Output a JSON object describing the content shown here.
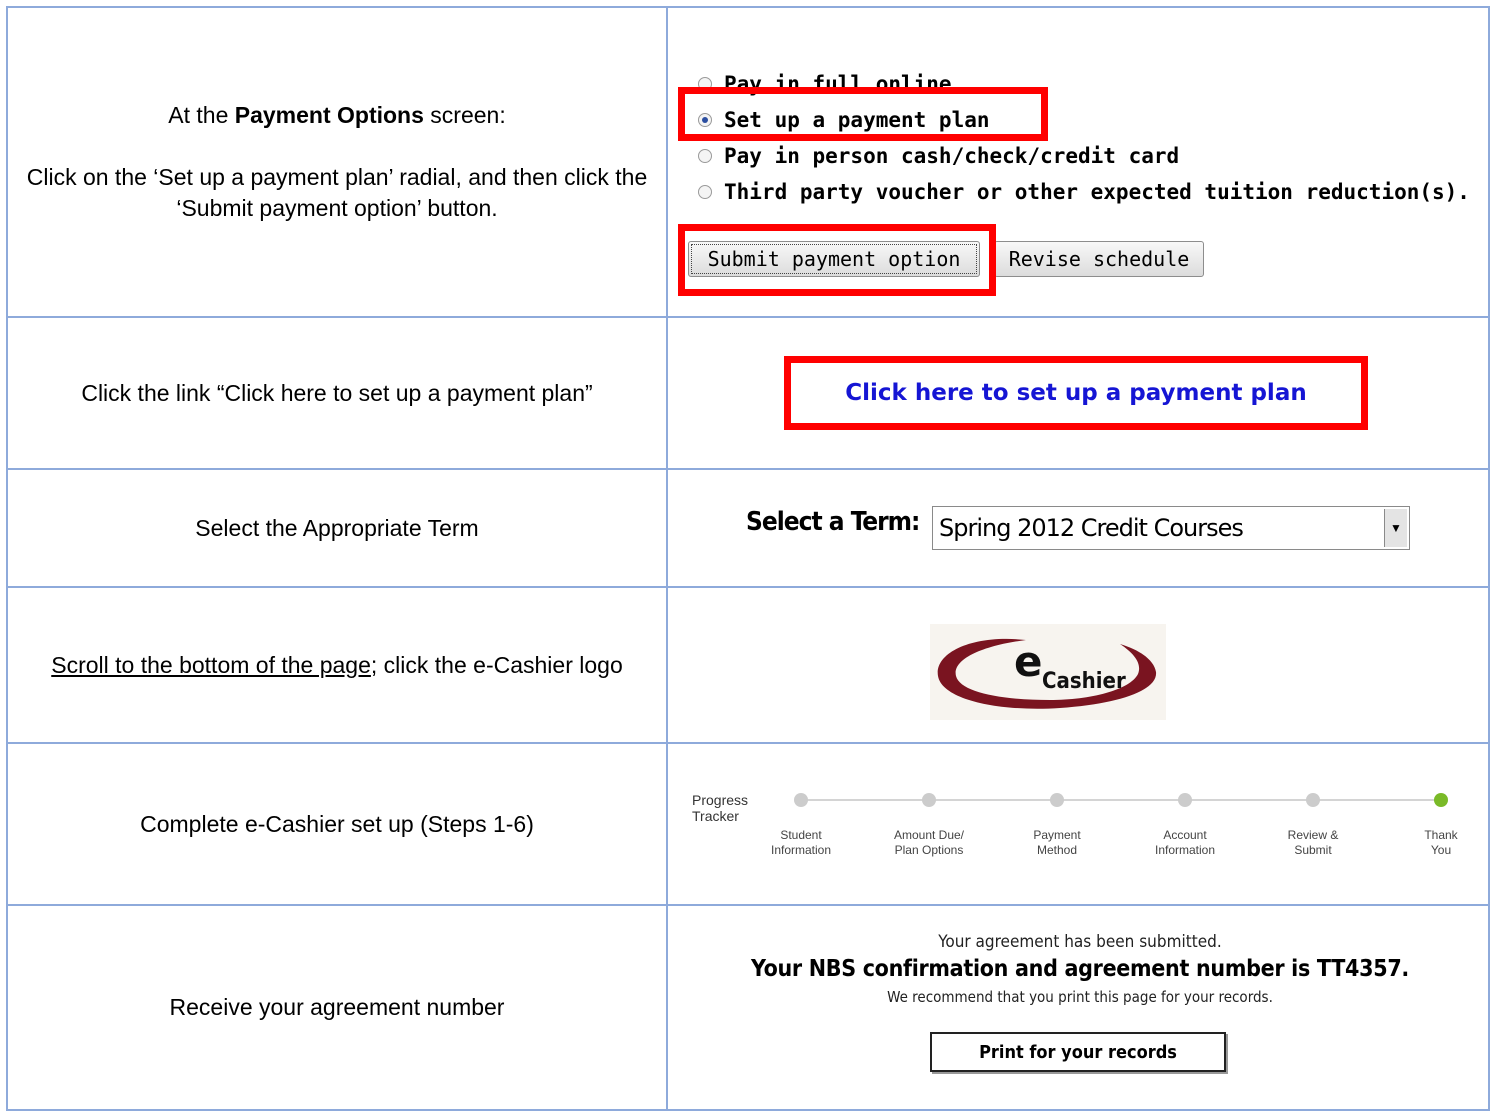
{
  "rows": [
    {
      "left": {
        "line1_pre": "At the ",
        "line1_bold": "Payment Options",
        "line1_post": " screen:",
        "line2": "Click on the ‘Set up a payment plan’ radial, and then click the ‘Submit payment option’ button."
      },
      "right": {
        "options": [
          {
            "label": "Pay in full online",
            "selected": false
          },
          {
            "label": "Set up a payment plan",
            "selected": true
          },
          {
            "label": "Pay in person cash/check/credit card",
            "selected": false
          },
          {
            "label": "Third party voucher or other expected tuition reduction(s).",
            "selected": false
          }
        ],
        "submit_label": "Submit payment option",
        "revise_label": "Revise schedule"
      }
    },
    {
      "left": {
        "text": "Click the link “Click here to set up a payment plan”"
      },
      "right": {
        "link_text": "Click here to set up a payment plan"
      }
    },
    {
      "left": {
        "text": "Select the Appropriate Term"
      },
      "right": {
        "label": "Select a Term:",
        "selected_term": "Spring 2012 Credit Courses"
      }
    },
    {
      "left": {
        "underlined": "Scroll to the bottom of the page",
        "rest": "; click the e-Cashier logo"
      },
      "right": {
        "logo_e": "e",
        "logo_text": "Cashier"
      }
    },
    {
      "left": {
        "text": "Complete e-Cashier set up (Steps 1-6)"
      },
      "right": {
        "title_line1": "Progress",
        "title_line2": "Tracker",
        "steps": [
          {
            "l1": "Student",
            "l2": "Information",
            "done": false
          },
          {
            "l1": "Amount Due/",
            "l2": "Plan Options",
            "done": false
          },
          {
            "l1": "Payment",
            "l2": "Method",
            "done": false
          },
          {
            "l1": "Account",
            "l2": "Information",
            "done": false
          },
          {
            "l1": "Review &",
            "l2": "Submit",
            "done": false
          },
          {
            "l1": "Thank",
            "l2": "You",
            "done": true
          }
        ],
        "done_color": "#7aba28"
      }
    },
    {
      "left": {
        "text": "Receive your agreement number"
      },
      "right": {
        "line1": "Your agreement has been submitted.",
        "line2": "Your NBS confirmation and agreement number is TT4357.",
        "line3": "We recommend that you print this page for your records.",
        "print_label": "Print for your records"
      }
    }
  ],
  "colors": {
    "highlight": "#ff0000",
    "link": "#1515d4",
    "border": "#8eaadb"
  }
}
